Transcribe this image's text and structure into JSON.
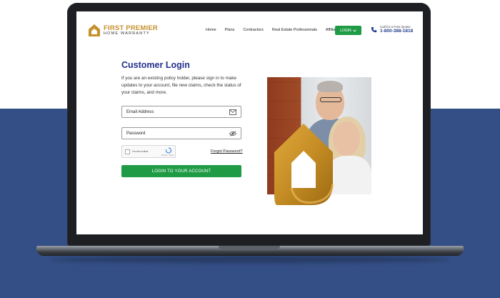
{
  "brand": {
    "name_line1": "FIRST PREMIER",
    "name_line2": "HOME WARRANTY",
    "colors": {
      "gold": "#c6912c",
      "navy": "#23308d",
      "green": "#1f9b45",
      "backdrop": "#344f86"
    }
  },
  "nav": {
    "items": [
      "Home",
      "Plans",
      "Contractors",
      "Real Estate Professionals",
      "Affiliates"
    ],
    "login_label": "LOGIN",
    "login_icon": "chevron-down-icon"
  },
  "contact": {
    "caption": "Call for a Free Quote:",
    "phone": "1-800-388-1818",
    "icon": "phone-icon"
  },
  "login_form": {
    "title": "Customer Login",
    "intro": "If you are an existing policy holder, please sign in to make updates to your account, file new claims, check the status of your claims, and more.",
    "email_placeholder": "Email Address",
    "email_icon": "envelope-icon",
    "password_placeholder": "Password",
    "password_icon": "eye-icon",
    "captcha_label": "I'm not a robot",
    "captcha_sub": "Privacy - Terms",
    "forgot_password": "Forgot Password?",
    "submit_label": "LOGIN TO YOUR ACCOUNT"
  }
}
